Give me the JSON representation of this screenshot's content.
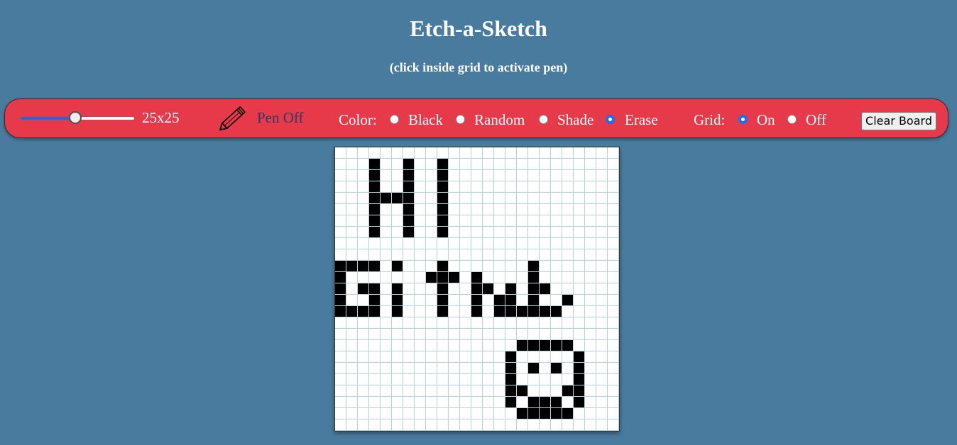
{
  "header": {
    "title": "Etch-a-Sketch",
    "subtitle": "(click inside grid to activate pen)"
  },
  "toolbar": {
    "size_slider": {
      "min": 0,
      "max": 1,
      "value_fraction": 0.48
    },
    "size_label": "25x25",
    "pen_icon": "pencil-icon",
    "pen_label": "Pen Off",
    "color_label": "Color:",
    "color_options": [
      "Black",
      "Random",
      "Shade",
      "Erase"
    ],
    "color_selected": "Erase",
    "grid_label": "Grid:",
    "grid_options": [
      "On",
      "Off"
    ],
    "grid_selected": "On",
    "clear_label": "Clear Board"
  },
  "colors": {
    "background": "#487b9d",
    "toolbar": "#e63a4b",
    "accent": "#1c6ef2",
    "ink": "#000000",
    "grid_line": "#b7d3da"
  },
  "grid": {
    "size": 25,
    "rows": [
      ".........................",
      "...X..X..X...............",
      "...X..X..X...............",
      "...X..X..X...............",
      "...XXXX..X...............",
      "...X..X..X...............",
      "...X..X..X...............",
      "...X..X..X...............",
      ".........................",
      ".........................",
      "XXXX.X...X.......X.......",
      "X.......XXX.X....X.......",
      "X.XX.X...X..XX.X.XX......",
      "X..X.X...X..X.XX.X..X....",
      "XXXX.X...X..X.XXXXXX.....",
      ".........................",
      ".........................",
      "................XXXXX....",
      "...............X.....X...",
      "...............X.X.X.X...",
      "...............X.....X...",
      "...............XX...XX...",
      "...............X.XXX.X...",
      "................XXXXX....",
      "........................."
    ]
  }
}
